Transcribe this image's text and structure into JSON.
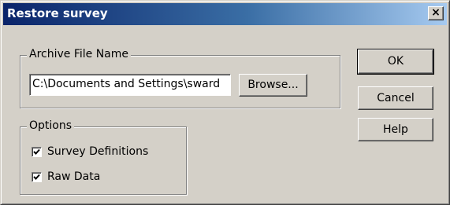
{
  "window": {
    "title": "Restore survey",
    "close_glyph": "×",
    "close_icon": "close-icon"
  },
  "archive": {
    "legend": "Archive File Name",
    "file_path": "C:\\Documents and Settings\\sward",
    "browse_label": "Browse..."
  },
  "options": {
    "legend": "Options",
    "items": [
      {
        "label": "Survey Definitions",
        "checked": true,
        "icon": "checkmark-icon"
      },
      {
        "label": "Raw Data",
        "checked": true,
        "icon": "checkmark-icon"
      }
    ]
  },
  "buttons": {
    "ok_label": "OK",
    "cancel_label": "Cancel",
    "help_label": "Help"
  },
  "colors": {
    "face": "#d4d0c8",
    "title_start": "#0a246a",
    "title_end": "#a6caf0",
    "title_text": "#ffffff"
  }
}
